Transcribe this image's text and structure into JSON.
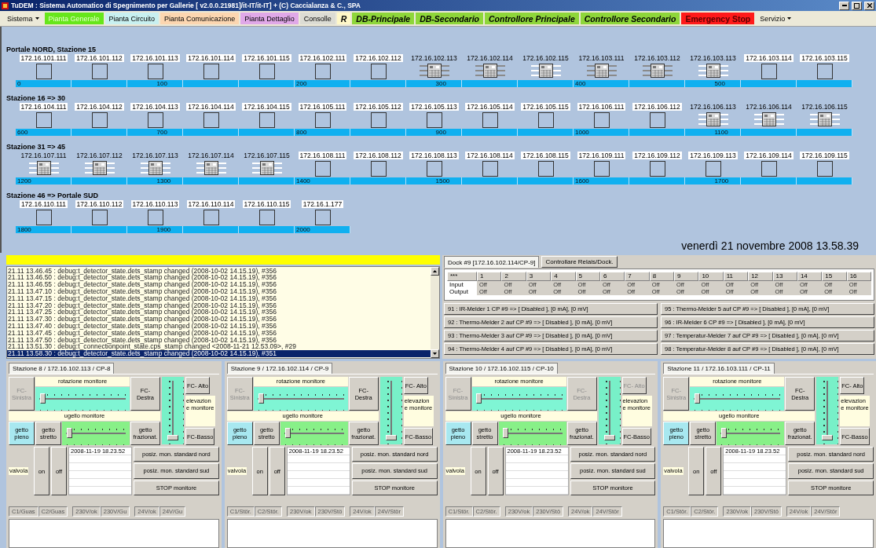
{
  "window": {
    "title": "TuDEM : Sistema Automatico di Spegnimento per Gallerie [ v2.0.0.21981]/it-IT/it-IT] + (C) Caccialanza & C., SPA"
  },
  "menu": [
    {
      "label": "Sistema",
      "kind": "dropdown",
      "color": "#ece9d8",
      "selected": false
    },
    {
      "label": "Pianta Generale",
      "kind": "view",
      "color": "#66e61a",
      "selected": true
    },
    {
      "label": "Pianta Circuito",
      "kind": "view",
      "color": "#c8f0f0",
      "selected": false
    },
    {
      "label": "Pianta Comunicazione",
      "kind": "view",
      "color": "#fcd6b0",
      "selected": false
    },
    {
      "label": "Pianta Dettaglio",
      "kind": "view",
      "color": "#e0a8e8",
      "selected": false
    },
    {
      "label": "Consolle",
      "kind": "view",
      "color": "#dcdcd4",
      "selected": false
    },
    {
      "label": "R",
      "kind": "shortcut",
      "color": "#fff8c8",
      "selected": false
    },
    {
      "label": "DB-Principale",
      "kind": "shortcut",
      "color": "#8ed63a",
      "selected": false
    },
    {
      "label": "DB-Secondario",
      "kind": "shortcut",
      "color": "#8ed63a",
      "selected": false
    },
    {
      "label": "Controllore Principale",
      "kind": "shortcut",
      "color": "#8ed63a",
      "selected": false
    },
    {
      "label": "Controllore Secondario",
      "kind": "shortcut",
      "color": "#8ed63a",
      "selected": false
    },
    {
      "label": "Emergency Stop",
      "kind": "alarm",
      "color": "#ff1a1a",
      "selected": false
    },
    {
      "label": "Servizio",
      "kind": "dropdown",
      "color": "#ece9d8",
      "selected": false
    }
  ],
  "map": {
    "rows": [
      {
        "title": "Portale NORD, Stazione 15",
        "scale": [
          "0",
          "100",
          "200",
          "300",
          "400",
          "500"
        ],
        "nodes": [
          {
            "ip": "172.16.101.111",
            "kind": "box"
          },
          {
            "ip": "172.16.101.112",
            "kind": "box"
          },
          {
            "ip": "172.16.101.113",
            "kind": "box"
          },
          {
            "ip": "172.16.101.114",
            "kind": "box"
          },
          {
            "ip": "172.16.101.115",
            "kind": "box"
          },
          {
            "ip": "172.16.102.111",
            "kind": "box"
          },
          {
            "ip": "172.16.102.112",
            "kind": "box"
          },
          {
            "ip": "172.16.102.113",
            "kind": "device"
          },
          {
            "ip": "172.16.102.114",
            "kind": "device"
          },
          {
            "ip": "172.16.102.115",
            "kind": "device-lit"
          },
          {
            "ip": "172.16.103.111",
            "kind": "device"
          },
          {
            "ip": "172.16.103.112",
            "kind": "device"
          },
          {
            "ip": "172.16.103.113",
            "kind": "device-lit"
          },
          {
            "ip": "172.16.103.114",
            "kind": "box"
          },
          {
            "ip": "172.16.103.115",
            "kind": "box"
          }
        ]
      },
      {
        "title": "Stazione 16 => 30",
        "scale": [
          "600",
          "700",
          "800",
          "900",
          "1000",
          "1100"
        ],
        "nodes": [
          {
            "ip": "172.16.104.111",
            "kind": "box"
          },
          {
            "ip": "172.16.104.112",
            "kind": "box"
          },
          {
            "ip": "172.16.104.113",
            "kind": "box"
          },
          {
            "ip": "172.16.104.114",
            "kind": "box"
          },
          {
            "ip": "172.16.104.115",
            "kind": "box"
          },
          {
            "ip": "172.16.105.111",
            "kind": "box"
          },
          {
            "ip": "172.16.105.112",
            "kind": "box"
          },
          {
            "ip": "172.16.105.113",
            "kind": "box"
          },
          {
            "ip": "172.16.105.114",
            "kind": "box"
          },
          {
            "ip": "172.16.105.115",
            "kind": "box"
          },
          {
            "ip": "172.16.106.111",
            "kind": "box"
          },
          {
            "ip": "172.16.106.112",
            "kind": "box"
          },
          {
            "ip": "172.16.106.113",
            "kind": "device-lit"
          },
          {
            "ip": "172.16.106.114",
            "kind": "device-lit"
          },
          {
            "ip": "172.16.106.115",
            "kind": "device-lit"
          }
        ]
      },
      {
        "title": "Stazione 31 => 45",
        "scale": [
          "1200",
          "1300",
          "1400",
          "1500",
          "1600",
          "1700"
        ],
        "nodes": [
          {
            "ip": "172.16.107.111",
            "kind": "device-lit"
          },
          {
            "ip": "172.16.107.112",
            "kind": "device-lit"
          },
          {
            "ip": "172.16.107.113",
            "kind": "device-lit"
          },
          {
            "ip": "172.16.107.114",
            "kind": "device-lit"
          },
          {
            "ip": "172.16.107.115",
            "kind": "device-lit"
          },
          {
            "ip": "172.16.108.111",
            "kind": "box"
          },
          {
            "ip": "172.16.108.112",
            "kind": "box"
          },
          {
            "ip": "172.16.108.113",
            "kind": "box"
          },
          {
            "ip": "172.16.108.114",
            "kind": "box"
          },
          {
            "ip": "172.16.108.115",
            "kind": "box"
          },
          {
            "ip": "172.16.109.111",
            "kind": "box"
          },
          {
            "ip": "172.16.109.112",
            "kind": "box"
          },
          {
            "ip": "172.16.109.113",
            "kind": "box"
          },
          {
            "ip": "172.16.109.114",
            "kind": "box"
          },
          {
            "ip": "172.16.109.115",
            "kind": "box"
          }
        ]
      },
      {
        "title": "Stazione 46 => Portale SUD",
        "scale": [
          "1800",
          "1900",
          "2000"
        ],
        "nodes": [
          {
            "ip": "172.16.110.111",
            "kind": "box"
          },
          {
            "ip": "172.16.110.112",
            "kind": "box"
          },
          {
            "ip": "172.16.110.113",
            "kind": "box"
          },
          {
            "ip": "172.16.110.114",
            "kind": "box"
          },
          {
            "ip": "172.16.110.115",
            "kind": "box"
          },
          {
            "ip": "172.16.1.177",
            "kind": "box"
          }
        ]
      }
    ],
    "datetime": "venerdì 21 novembre 2008 13.58.39"
  },
  "log": {
    "lines": [
      {
        "text": "21.11 13.46.45 : debug:t_detector_state.dets_stamp changed (2008-10-02 14.15.19), #356",
        "selected": false
      },
      {
        "text": "21.11 13.46.50 : debug:t_detector_state.dets_stamp changed (2008-10-02 14.15.19), #356",
        "selected": false
      },
      {
        "text": "21.11 13.46.55 : debug:t_detector_state.dets_stamp changed (2008-10-02 14.15.19), #356",
        "selected": false
      },
      {
        "text": "21.11 13.47.10 : debug:t_detector_state.dets_stamp changed (2008-10-02 14.15.19), #356",
        "selected": false
      },
      {
        "text": "21.11 13.47.15 : debug:t_detector_state.dets_stamp changed (2008-10-02 14.15.19), #356",
        "selected": false
      },
      {
        "text": "21.11 13.47.20 : debug:t_detector_state.dets_stamp changed (2008-10-02 14.15.19), #356",
        "selected": false
      },
      {
        "text": "21.11 13.47.25 : debug:t_detector_state.dets_stamp changed (2008-10-02 14.15.19), #356",
        "selected": false
      },
      {
        "text": "21.11 13.47.30 : debug:t_detector_state.dets_stamp changed (2008-10-02 14.15.19), #356",
        "selected": false
      },
      {
        "text": "21.11 13.47.40 : debug:t_detector_state.dets_stamp changed (2008-10-02 14.15.19), #356",
        "selected": false
      },
      {
        "text": "21.11 13.47.45 : debug:t_detector_state.dets_stamp changed (2008-10-02 14.15.19), #356",
        "selected": false
      },
      {
        "text": "21.11 13.47.50 : debug:t_detector_state.dets_stamp changed (2008-10-02 14.15.19), #356",
        "selected": false
      },
      {
        "text": "21.11 13.51.30 : debug:t_connectionpoint_state.cps_stamp changed <2008-11-21 12.53.09>, #29",
        "selected": false
      },
      {
        "text": "21.11 13.58.30 : debug:t_detector_state.dets_stamp changed (2008-10-02 14.15.19), #351",
        "selected": true
      }
    ]
  },
  "dock": {
    "tab": "Dock #9 [172.16.102.114/CP-9]",
    "relay_button": "Controllare Relais/Dock.",
    "io_table": {
      "corner": "***",
      "columns": [
        "1",
        "2",
        "3",
        "4",
        "5",
        "6",
        "7",
        "8",
        "9",
        "10",
        "11",
        "12",
        "13",
        "14",
        "15",
        "16"
      ],
      "rows": [
        {
          "label": "Input",
          "values": [
            "Off",
            "Off",
            "Off",
            "Off",
            "Off",
            "Off",
            "Off",
            "Off",
            "Off",
            "Off",
            "Off",
            "Off",
            "Off",
            "Off",
            "Off",
            "Off"
          ]
        },
        {
          "label": "Output",
          "values": [
            "Off",
            "Off",
            "Off",
            "Off",
            "Off",
            "Off",
            "Off",
            "Off",
            "Off",
            "Off",
            "Off",
            "Off",
            "Off",
            "Off",
            "Off",
            "Off"
          ]
        }
      ]
    },
    "detectors": [
      "91 : IR-Melder 1 CP #9 => [ Disabled ], [0 mA], [0 mV]",
      "92 : Thermo-Melder 2 auf CP #9 => [ Disabled ], [0 mA], [0 mV]",
      "93 : Thermo-Melder 3 auf CP #9 => [ Disabled ], [0 mA], [0 mV]",
      "94 : Thermo-Melder 4 auf CP #9 => [ Disabled ], [0 mA], [0 mV]",
      "95 : Thermo-Melder 5 auf CP #9 => [ Disabled ], [0 mA], [0 mV]",
      "96 : IR-Melder 6 CP #9 => [ Disabled ], [0 mA], [0 mV]",
      "97 : Temperatur-Melder 7 auf CP #9 => [ Disabled ], [0 mA], [0 mV]",
      "98 : Temperatur-Melder 8 auf CP #9 => [ Disabled ], [0 mA], [0 mV]"
    ]
  },
  "stations": [
    {
      "title": "Stazione 8 / 172.16.102.113 / CP-8",
      "rotation": {
        "label": "rotazione monitore",
        "level": 0.04
      },
      "nozzle": {
        "label": "ugello monitore",
        "level": 0.04
      },
      "elevation": {
        "label": "elevazion e monitore",
        "level": 0.03
      },
      "fc_buttons": [
        {
          "label": "FC-Sinistra",
          "disabled": true
        },
        {
          "label": "FC-Destra",
          "disabled": false
        },
        {
          "label": "FC- Alto",
          "disabled": false
        },
        {
          "label": "FC-Basso",
          "disabled": false
        }
      ],
      "jet_modes": [
        {
          "label": "getto pieno",
          "selected": true
        },
        {
          "label": "getto stretto",
          "selected": false
        },
        {
          "label": "getto frazionat.",
          "selected": false
        }
      ],
      "valve": {
        "label": "valvola",
        "on": "on",
        "off": "off"
      },
      "timestamps": [
        "2008-11-19 18.23.52"
      ],
      "positions": [
        "posiz. mon. standard nord",
        "posiz. mon. standard sud",
        "STOP monitore"
      ],
      "status": [
        "C1/Guas",
        "C2/Guas",
        "230V/ok",
        "230V/Gu",
        "24V/ok",
        "24V/Gu"
      ]
    },
    {
      "title": "Stazione 9 / 172.16.102.114 / CP-9",
      "rotation": {
        "label": "rotazione monitore",
        "level": 0.04
      },
      "nozzle": {
        "label": "ugello monitore",
        "level": 0.04
      },
      "elevation": {
        "label": "elevazion e monitore",
        "level": 0.03
      },
      "fc_buttons": [
        {
          "label": "FC-Sinistra",
          "disabled": true
        },
        {
          "label": "FC-Destra",
          "disabled": false
        },
        {
          "label": "FC- Alto",
          "disabled": false
        },
        {
          "label": "FC-Basso",
          "disabled": false
        }
      ],
      "jet_modes": [
        {
          "label": "getto pieno",
          "selected": true
        },
        {
          "label": "getto stretto",
          "selected": false
        },
        {
          "label": "getto frazionat.",
          "selected": false
        }
      ],
      "valve": {
        "label": "valvola",
        "on": "on",
        "off": "off"
      },
      "timestamps": [
        "2008-11-19 18.23.52"
      ],
      "positions": [
        "posiz. mon. standard nord",
        "posiz. mon. standard sud",
        "STOP monitore"
      ],
      "status": [
        "C1/Stör.",
        "C2/Stör.",
        "230V/ok",
        "230V/Stö",
        "24V/ok",
        "24V/Stör"
      ]
    },
    {
      "title": "Stazione 10 / 172.16.102.115 / CP-10",
      "rotation": {
        "label": "rotazione monitore",
        "level": 0.04
      },
      "nozzle": {
        "label": "ugello monitore",
        "level": 0.04
      },
      "elevation": {
        "label": "elevazion e monitore",
        "level": 0.03
      },
      "fc_buttons": [
        {
          "label": "FC-Sinistra",
          "disabled": true
        },
        {
          "label": "FC-Destra",
          "disabled": true
        },
        {
          "label": "FC- Alto",
          "disabled": true
        },
        {
          "label": "FC-Basso",
          "disabled": false
        }
      ],
      "jet_modes": [
        {
          "label": "getto pieno",
          "selected": true
        },
        {
          "label": "getto stretto",
          "selected": false
        },
        {
          "label": "getto frazionat.",
          "selected": false
        }
      ],
      "valve": {
        "label": "valvola",
        "on": "on",
        "off": "off"
      },
      "timestamps": [
        "2008-11-19 18.23.52"
      ],
      "positions": [
        "posiz. mon. standard nord",
        "posiz. mon. standard sud",
        "STOP monitore"
      ],
      "status": [
        "C1/Stör.",
        "C2/Stör.",
        "230V/ok",
        "230V/Stö",
        "24V/ok",
        "24V/Stör"
      ]
    },
    {
      "title": "Stazione 11 / 172.16.103.111 / CP-11",
      "rotation": {
        "label": "rotazione monitore",
        "level": 0.04
      },
      "nozzle": {
        "label": "ugello monitore",
        "level": 0.04
      },
      "elevation": {
        "label": "elevazion e monitore",
        "level": 0.03
      },
      "fc_buttons": [
        {
          "label": "FC-Sinistra",
          "disabled": true
        },
        {
          "label": "FC-Destra",
          "disabled": false
        },
        {
          "label": "FC- Alto",
          "disabled": false
        },
        {
          "label": "FC-Basso",
          "disabled": false
        }
      ],
      "jet_modes": [
        {
          "label": "getto pieno",
          "selected": true
        },
        {
          "label": "getto stretto",
          "selected": false
        },
        {
          "label": "getto frazionat.",
          "selected": false
        }
      ],
      "valve": {
        "label": "valvola",
        "on": "on",
        "off": "off"
      },
      "timestamps": [
        "2008-11-19 18.23.52"
      ],
      "positions": [
        "posiz. mon. standard nord",
        "posiz. mon. standard sud",
        "STOP monitore"
      ],
      "status": [
        "C1/Stör.",
        "C2/Stör.",
        "230V/ok",
        "230V/Stö",
        "24V/ok",
        "24V/Stör"
      ]
    }
  ]
}
